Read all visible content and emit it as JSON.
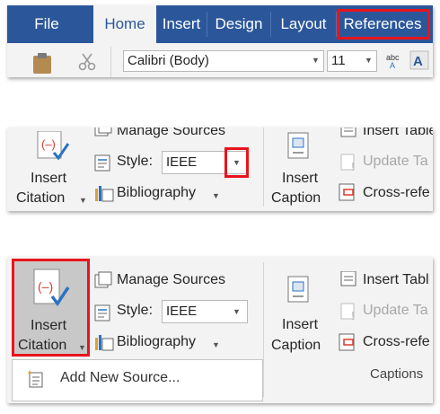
{
  "tabs": [
    "File",
    "Home",
    "Insert",
    "Design",
    "Layout",
    "References"
  ],
  "toolbar": {
    "font_name": "Calibri (Body)",
    "font_size": "11"
  },
  "references_ribbon": {
    "insert_citation_line1": "Insert",
    "insert_citation_line2": "Citation",
    "manage_sources": "Manage Sources",
    "style_label": "Style:",
    "style_value": "IEEE",
    "bibliography": "Bibliography",
    "insert_caption_line1": "Insert",
    "insert_caption_line2": "Caption",
    "insert_table": "Insert Table",
    "update_table": "Update Ta",
    "cross_reference": "Cross-refe"
  },
  "panel3": {
    "insert_table": "Insert Tabl",
    "update_table": "Update Ta",
    "cross_reference": "Cross-refe",
    "captions_group": "Captions",
    "menu_add_new_source": "Add New Source..."
  },
  "colors": {
    "ribbon_blue": "#2b579a",
    "highlight_red": "#e8141c",
    "icon_blue": "#2b72c2",
    "icon_red": "#d83b2c"
  }
}
